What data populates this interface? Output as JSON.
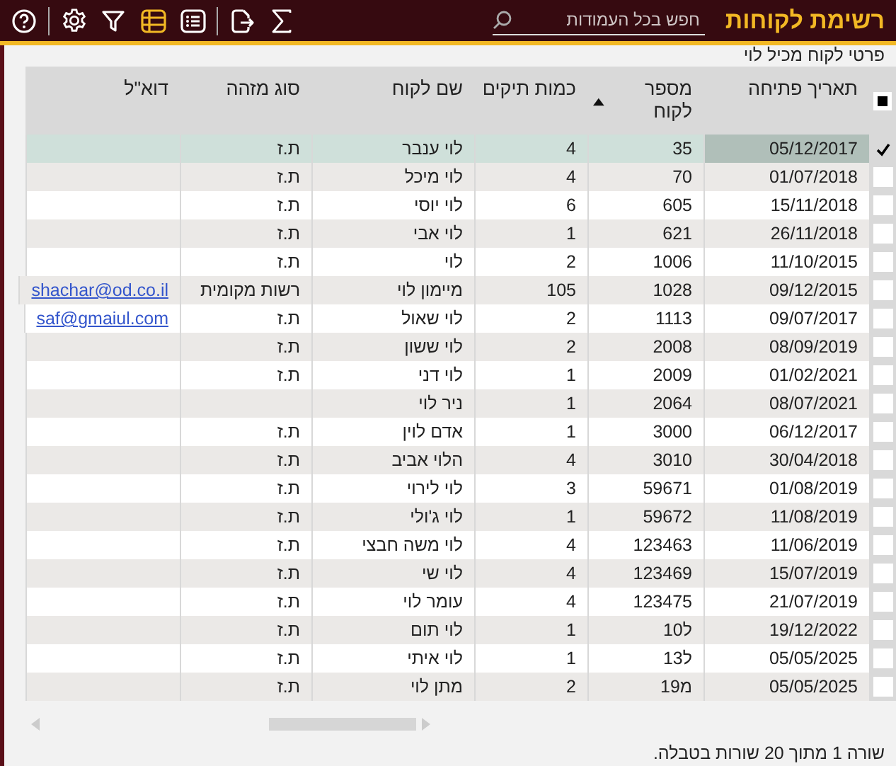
{
  "header": {
    "title": "רשימת לקוחות",
    "search": {
      "placeholder": "חפש בכל העמודות"
    },
    "toolbar": [
      {
        "kind": "help",
        "selected": false
      },
      {
        "kind": "settings",
        "selected": false
      },
      {
        "kind": "filter",
        "selected": false
      },
      {
        "kind": "table",
        "selected": true
      },
      {
        "kind": "list",
        "selected": false
      },
      {
        "kind": "export",
        "selected": false
      },
      {
        "kind": "sum",
        "selected": false
      }
    ]
  },
  "filter_caption": "פרטי לקוח מכיל לוי",
  "table": {
    "select_all": {
      "indeterminate": true
    },
    "columns": [
      {
        "label": "תאריך פתיחה",
        "sorted": false,
        "kind": "text"
      },
      {
        "label": "מספר לקוח",
        "sorted": true,
        "kind": "text"
      },
      {
        "label": "כמות תיקים",
        "sorted": false,
        "kind": "text"
      },
      {
        "label": "שם לקוח",
        "sorted": false,
        "kind": "text"
      },
      {
        "label": "סוג מזהה",
        "sorted": false,
        "kind": "text"
      },
      {
        "label": "דוא\"ל",
        "sorted": false,
        "kind": "link"
      }
    ],
    "rows": [
      {
        "selected": true,
        "cells": [
          "05/12/2017",
          "35",
          "4",
          "לוי ענבר",
          "ת.ז",
          ""
        ]
      },
      {
        "selected": false,
        "cells": [
          "01/07/2018",
          "70",
          "4",
          "לוי מיכל",
          "ת.ז",
          ""
        ]
      },
      {
        "selected": false,
        "cells": [
          "15/11/2018",
          "605",
          "6",
          "לוי יוסי",
          "ת.ז",
          ""
        ]
      },
      {
        "selected": false,
        "cells": [
          "26/11/2018",
          "621",
          "1",
          "לוי אבי",
          "ת.ז",
          ""
        ]
      },
      {
        "selected": false,
        "cells": [
          "11/10/2015",
          "1006",
          "2",
          "לוי",
          "ת.ז",
          ""
        ]
      },
      {
        "selected": false,
        "cells": [
          "09/12/2015",
          "1028",
          "105",
          "מיימון לוי",
          "רשות מקומית",
          "shachar@od.co.il"
        ]
      },
      {
        "selected": false,
        "cells": [
          "09/07/2017",
          "1113",
          "2",
          "לוי שאול",
          "ת.ז",
          "saf@gmaiul.com"
        ]
      },
      {
        "selected": false,
        "cells": [
          "08/09/2019",
          "2008",
          "2",
          "לוי ששון",
          "ת.ז",
          ""
        ]
      },
      {
        "selected": false,
        "cells": [
          "01/02/2021",
          "2009",
          "1",
          "לוי דני",
          "ת.ז",
          ""
        ]
      },
      {
        "selected": false,
        "cells": [
          "08/07/2021",
          "2064",
          "1",
          "ניר לוי",
          "",
          ""
        ]
      },
      {
        "selected": false,
        "cells": [
          "06/12/2017",
          "3000",
          "1",
          "אדם לוין",
          "ת.ז",
          ""
        ]
      },
      {
        "selected": false,
        "cells": [
          "30/04/2018",
          "3010",
          "4",
          "הלוי אביב",
          "ת.ז",
          ""
        ]
      },
      {
        "selected": false,
        "cells": [
          "01/08/2019",
          "59671",
          "3",
          "לוי לירוי",
          "ת.ז",
          ""
        ]
      },
      {
        "selected": false,
        "cells": [
          "11/08/2019",
          "59672",
          "1",
          "לוי  ג'ולי",
          "ת.ז",
          ""
        ]
      },
      {
        "selected": false,
        "cells": [
          "11/06/2019",
          "123463",
          "4",
          "לוי משה  חבצי",
          "ת.ז",
          ""
        ]
      },
      {
        "selected": false,
        "cells": [
          "15/07/2019",
          "123469",
          "4",
          "לוי  שי",
          "ת.ז",
          ""
        ]
      },
      {
        "selected": false,
        "cells": [
          "21/07/2019",
          "123475",
          "4",
          "עומר לוי",
          "ת.ז",
          ""
        ]
      },
      {
        "selected": false,
        "cells": [
          "19/12/2022",
          "ל10",
          "1",
          "לוי תום",
          "ת.ז",
          ""
        ]
      },
      {
        "selected": false,
        "cells": [
          "05/05/2025",
          "ל13",
          "1",
          "לוי איתי",
          "ת.ז",
          ""
        ]
      },
      {
        "selected": false,
        "cells": [
          "05/05/2025",
          "מ19",
          "2",
          "מתן לוי",
          "ת.ז",
          ""
        ]
      }
    ]
  },
  "status_bar": "שורה 1 מתוך 20 שורות בטבלה."
}
